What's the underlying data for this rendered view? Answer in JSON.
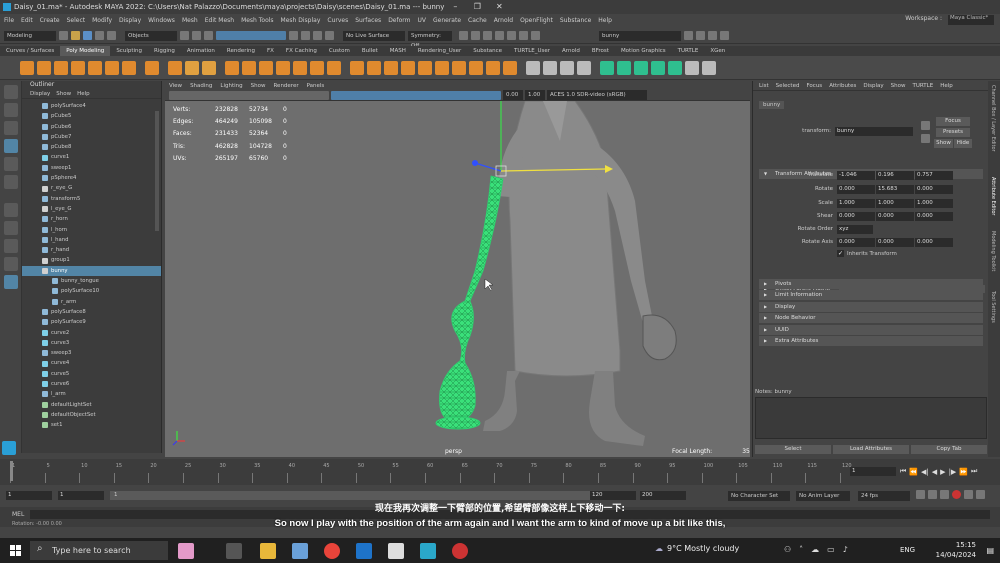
{
  "window": {
    "title": "Daisy_01.ma* - Autodesk MAYA 2022: C:\\Users\\Nat Palazzo\\Documents\\maya\\projects\\Daisy\\scenes\\Daisy_01.ma  ---  bunny"
  },
  "menubar": {
    "items": [
      "File",
      "Edit",
      "Create",
      "Select",
      "Modify",
      "Display",
      "Windows",
      "Mesh",
      "Edit Mesh",
      "Mesh Tools",
      "Mesh Display",
      "Curves",
      "Surfaces",
      "Deform",
      "UV",
      "Generate",
      "Cache",
      "Arnold",
      "OpenFlight",
      "Substance",
      "Help"
    ],
    "workspace_label": "Workspace :",
    "workspace_value": "Maya Classic*"
  },
  "statusline": {
    "mode": "Modeling",
    "select_mode": "Objects",
    "live_surface": "No Live Surface",
    "symmetry": "Symmetry: Off",
    "search_value": "bunny"
  },
  "shelf_tabs": [
    "Curves / Surfaces",
    "Poly Modeling",
    "Sculpting",
    "Rigging",
    "Animation",
    "Rendering",
    "FX",
    "FX Caching",
    "Custom",
    "Bullet",
    "MASH",
    "Rendering_User",
    "Substance",
    "TURTLE_User",
    "Arnold",
    "BFrost",
    "Motion Graphics",
    "TURTLE",
    "XGen"
  ],
  "shelf_active": "Poly Modeling",
  "outliner": {
    "title": "Outliner",
    "menu": [
      "Display",
      "Show",
      "Help"
    ],
    "items": [
      {
        "label": "polySurface4",
        "type": "mesh"
      },
      {
        "label": "pCube5",
        "type": "mesh"
      },
      {
        "label": "pCube6",
        "type": "mesh"
      },
      {
        "label": "pCube7",
        "type": "mesh"
      },
      {
        "label": "pCube8",
        "type": "mesh"
      },
      {
        "label": "curve1",
        "type": "curve"
      },
      {
        "label": "sweep1",
        "type": "mesh"
      },
      {
        "label": "pSphere4",
        "type": "mesh"
      },
      {
        "label": "r_eye_G",
        "type": "group"
      },
      {
        "label": "transform5",
        "type": "mesh"
      },
      {
        "label": "l_eye_G",
        "type": "group"
      },
      {
        "label": "r_horn",
        "type": "mesh"
      },
      {
        "label": "l_horn",
        "type": "mesh"
      },
      {
        "label": "l_hand",
        "type": "mesh"
      },
      {
        "label": "r_hand",
        "type": "mesh"
      },
      {
        "label": "group1",
        "type": "group"
      },
      {
        "label": "bunny",
        "type": "group",
        "selected": true
      },
      {
        "label": "bunny_tongue",
        "type": "mesh",
        "child": true
      },
      {
        "label": "polySurface10",
        "type": "mesh",
        "child": true
      },
      {
        "label": "r_arm",
        "type": "mesh",
        "child": true
      },
      {
        "label": "polySurface8",
        "type": "mesh"
      },
      {
        "label": "polySurface9",
        "type": "mesh"
      },
      {
        "label": "curve2",
        "type": "curve"
      },
      {
        "label": "curve3",
        "type": "curve"
      },
      {
        "label": "sweep3",
        "type": "mesh"
      },
      {
        "label": "curve4",
        "type": "curve"
      },
      {
        "label": "curve5",
        "type": "curve"
      },
      {
        "label": "curve6",
        "type": "curve"
      },
      {
        "label": "l_arm",
        "type": "mesh"
      },
      {
        "label": "defaultLightSet",
        "type": "set"
      },
      {
        "label": "defaultObjectSet",
        "type": "set"
      },
      {
        "label": "set1",
        "type": "set"
      }
    ]
  },
  "viewport": {
    "menu": [
      "View",
      "Shading",
      "Lighting",
      "Show",
      "Renderer",
      "Panels"
    ],
    "exposure": "0.00",
    "gamma": "1.00",
    "colorspace": "ACES 1.0 SDR-video (sRGB)",
    "stats": [
      {
        "label": "Verts:",
        "a": "232828",
        "b": "52734",
        "c": "0"
      },
      {
        "label": "Edges:",
        "a": "464249",
        "b": "105098",
        "c": "0"
      },
      {
        "label": "Faces:",
        "a": "231433",
        "b": "52364",
        "c": "0"
      },
      {
        "label": "Tris:",
        "a": "462828",
        "b": "104728",
        "c": "0"
      },
      {
        "label": "UVs:",
        "a": "265197",
        "b": "65760",
        "c": "0"
      }
    ],
    "camera": "persp",
    "focal_label": "Focal Length:",
    "focal_value": "35"
  },
  "attr_editor": {
    "tabs": [
      "List",
      "Selected",
      "Focus",
      "Attributes",
      "Display",
      "Show",
      "TURTLE",
      "Help"
    ],
    "node_tab": "bunny",
    "transform_label": "transform:",
    "transform_value": "bunny",
    "buttons": {
      "focus": "Focus",
      "presets": "Presets",
      "show": "Show",
      "hide": "Hide"
    },
    "section_transform": "Transform Attributes",
    "translate": {
      "label": "Translate",
      "x": "-1.046",
      "y": "0.196",
      "z": "0.757"
    },
    "rotate": {
      "label": "Rotate",
      "x": "0.000",
      "y": "15.683",
      "z": "0.000"
    },
    "scale": {
      "label": "Scale",
      "x": "1.000",
      "y": "1.000",
      "z": "1.000"
    },
    "shear": {
      "label": "Shear",
      "x": "0.000",
      "y": "0.000",
      "z": "0.000"
    },
    "rotate_order": {
      "label": "Rotate Order",
      "value": "xyz"
    },
    "rotate_axis": {
      "label": "Rotate Axis",
      "x": "0.000",
      "y": "0.000",
      "z": "0.000"
    },
    "inherits": "Inherits Transform",
    "offset_parent": "Offset Parent Matrix",
    "sections": [
      "Pivots",
      "Limit Information",
      "Display",
      "Node Behavior",
      "UUID",
      "Extra Attributes"
    ],
    "notes_label": "Notes:  bunny",
    "bottom_buttons": [
      "Select",
      "Load Attributes",
      "Copy Tab"
    ]
  },
  "side_tabs": [
    "Channel Box / Layer Editor",
    "Attribute Editor",
    "Modeling Toolkit",
    "Tool Settings"
  ],
  "timeline": {
    "ticks": [
      "1",
      "5",
      "10",
      "15",
      "20",
      "25",
      "30",
      "35",
      "40",
      "45",
      "50",
      "55",
      "60",
      "65",
      "70",
      "75",
      "80",
      "85",
      "90",
      "95",
      "100",
      "105",
      "110",
      "115",
      "120"
    ],
    "current_frame": "1"
  },
  "range": {
    "start": "1",
    "start2": "1",
    "range_start": "1",
    "range_end": "120",
    "end": "120",
    "end2": "200",
    "charset": "No Character Set",
    "anim_layer": "No Anim Layer",
    "fps": "24 fps"
  },
  "cmd": {
    "lang": "MEL",
    "help": "Rotation:  -0.00   0.00"
  },
  "subtitles": {
    "cn": "现在我再次调整一下臂部的位置,希望臂部像这样上下移动一下:",
    "en": "So now I play with the position of the arm again and I want the arm to kind of move up a bit like this,"
  },
  "taskbar": {
    "search_placeholder": "Type here to search",
    "weather": "9°C  Mostly cloudy",
    "lang": "ENG",
    "time": "15:15",
    "date": "14/04/2024"
  },
  "colors": {
    "selection": "#5285a6",
    "wireframe": "#33ff88",
    "accent": "#2a9fd6"
  }
}
